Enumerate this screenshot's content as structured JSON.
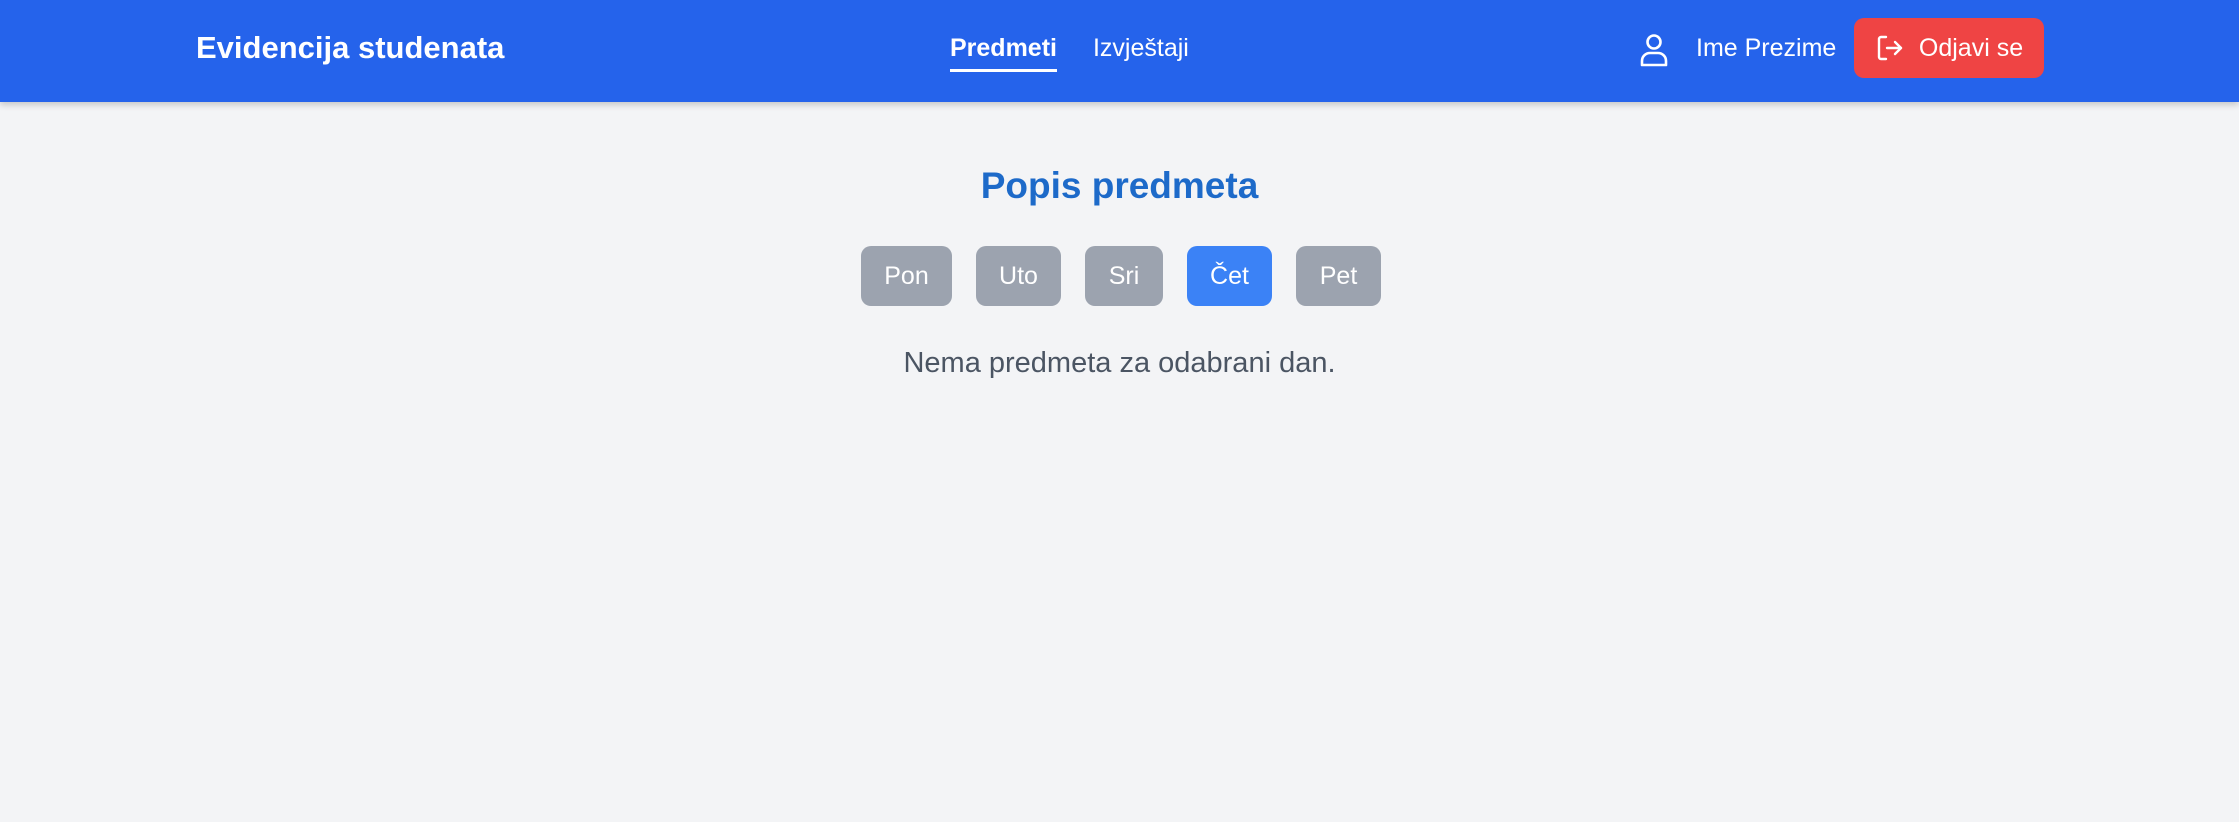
{
  "header": {
    "brand": "Evidencija studenata",
    "nav": [
      {
        "label": "Predmeti",
        "active": true
      },
      {
        "label": "Izvještaji",
        "active": false
      }
    ],
    "user": {
      "icon": "user-icon",
      "name": "Ime Prezime"
    },
    "logout": {
      "icon": "logout-icon",
      "label": "Odjavi se"
    }
  },
  "main": {
    "title": "Popis predmeta",
    "days": [
      {
        "label": "Pon",
        "selected": false
      },
      {
        "label": "Uto",
        "selected": false
      },
      {
        "label": "Sri",
        "selected": false
      },
      {
        "label": "Čet",
        "selected": true
      },
      {
        "label": "Pet",
        "selected": false
      }
    ],
    "empty_message": "Nema predmeta za odabrani dan."
  },
  "colors": {
    "navbar": "#2563eb",
    "logout": "#ef4444",
    "day_default": "#9ca3af",
    "day_selected": "#3b82f6",
    "title": "#1d6ac9",
    "background": "#f3f4f6"
  }
}
